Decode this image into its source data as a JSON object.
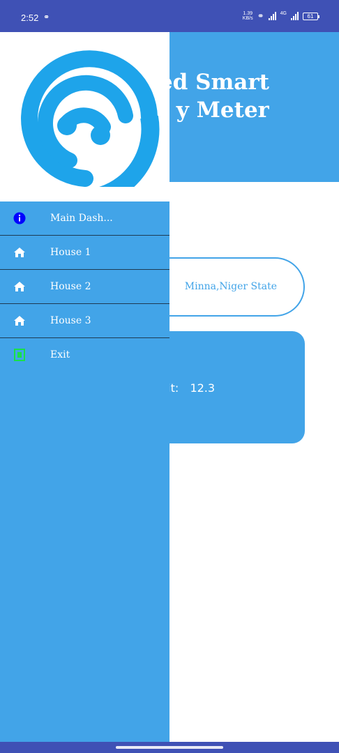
{
  "status_bar": {
    "time": "2:52",
    "speed_value": "1.39",
    "speed_unit": "KB/s",
    "network_type": "4G",
    "battery_level": "61"
  },
  "header": {
    "title_line1": "ed Smart",
    "title_line2": "y Meter"
  },
  "location": {
    "text": "Minna,Niger State"
  },
  "unit_card": {
    "label": "nit:",
    "value": "12.3"
  },
  "drawer": {
    "items": [
      {
        "label": "Main Dash...",
        "icon": "info-icon"
      },
      {
        "label": "House 1",
        "icon": "home-icon"
      },
      {
        "label": "House 2",
        "icon": "home-icon"
      },
      {
        "label": "House 3",
        "icon": "home-icon"
      },
      {
        "label": "Exit",
        "icon": "exit-icon"
      }
    ]
  },
  "colors": {
    "primary": "#42a4e8",
    "status_bar": "#3f51b5",
    "logo": "#1ea4ea",
    "info_icon": "#0000ff",
    "exit_icon": "#19e04a"
  }
}
